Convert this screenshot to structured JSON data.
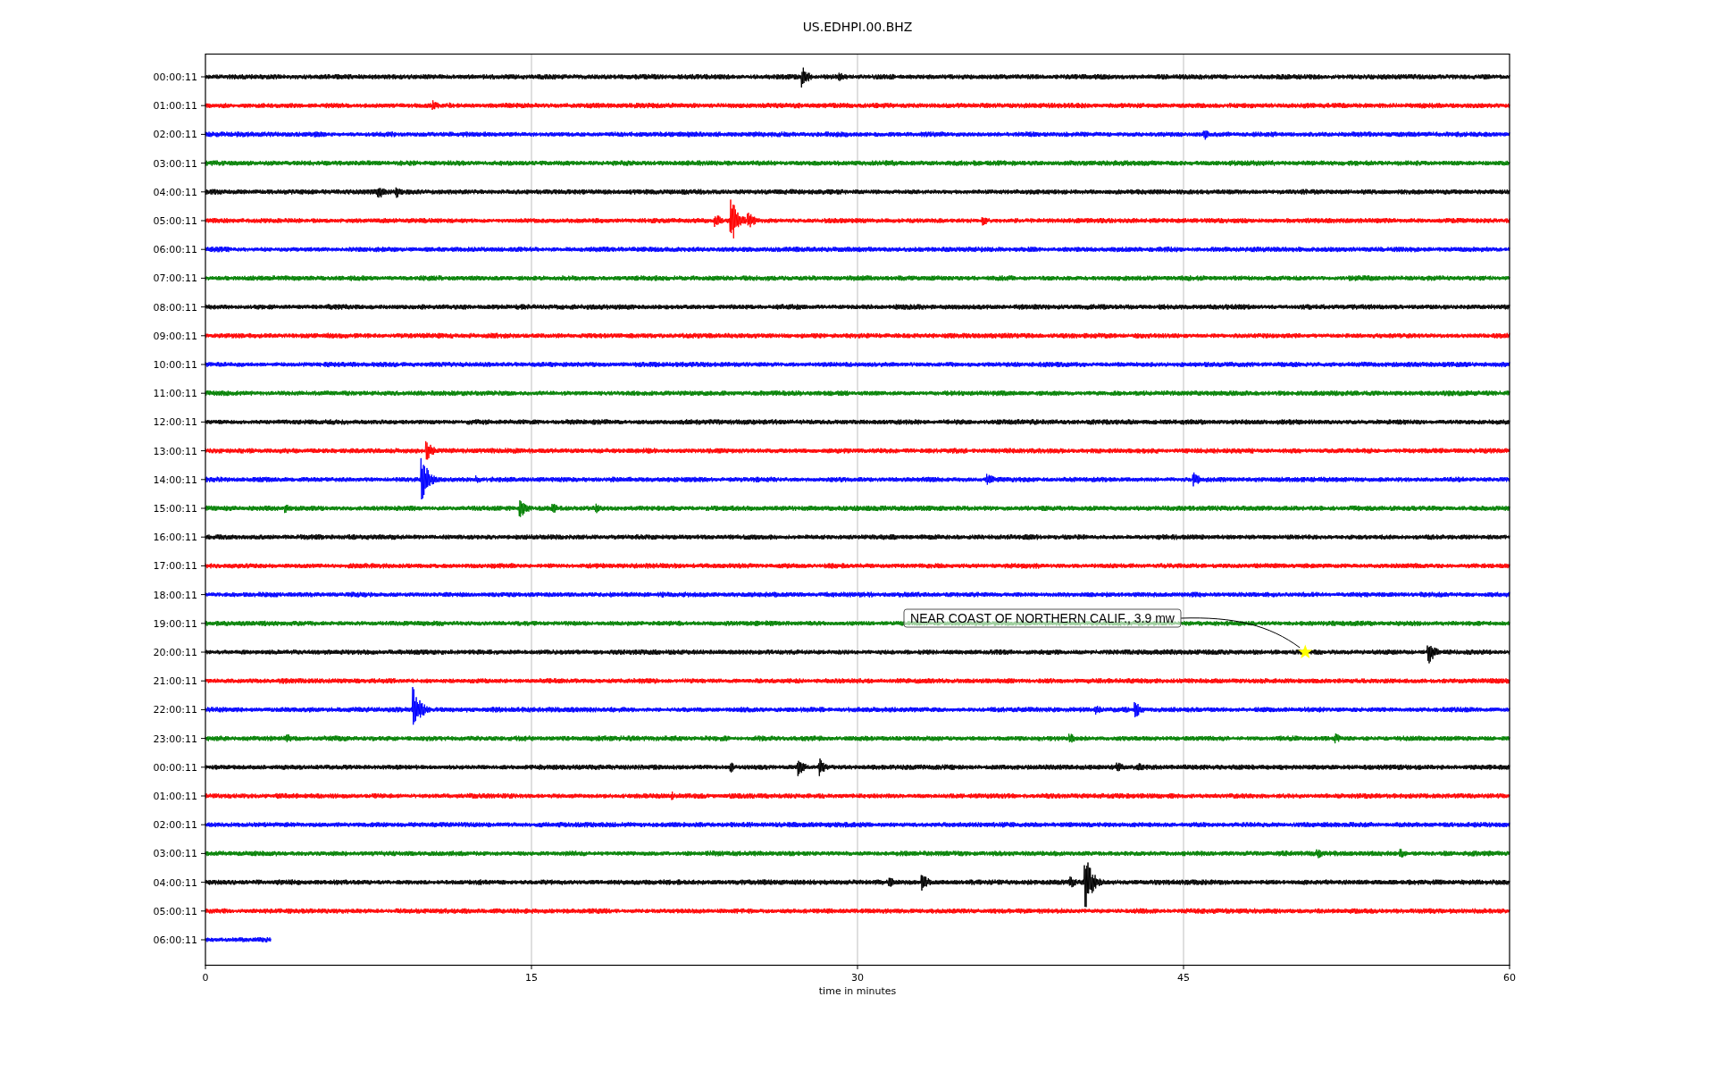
{
  "title": "US.EDHPI.00.BHZ",
  "plot": {
    "xlabel": "time in minutes",
    "xticks": [
      "0",
      "15",
      "30",
      "45",
      "60"
    ],
    "rows": [
      {
        "label": "00:00:11",
        "color": "#000000",
        "level": 1
      },
      {
        "label": "01:00:11",
        "color": "#ff0000",
        "level": 1
      },
      {
        "label": "02:00:11",
        "color": "#0000ff",
        "level": 1
      },
      {
        "label": "03:00:11",
        "color": "#008000",
        "level": 1
      },
      {
        "label": "04:00:11",
        "color": "#000000",
        "level": 1
      },
      {
        "label": "05:00:11",
        "color": "#ff0000",
        "level": 1
      },
      {
        "label": "06:00:11",
        "color": "#0000ff",
        "level": 1
      },
      {
        "label": "07:00:11",
        "color": "#008000",
        "level": 1
      },
      {
        "label": "08:00:11",
        "color": "#000000",
        "level": 1
      },
      {
        "label": "09:00:11",
        "color": "#ff0000",
        "level": 1
      },
      {
        "label": "10:00:11",
        "color": "#0000ff",
        "level": 1
      },
      {
        "label": "11:00:11",
        "color": "#008000",
        "level": 1
      },
      {
        "label": "12:00:11",
        "color": "#000000",
        "level": 1
      },
      {
        "label": "13:00:11",
        "color": "#ff0000",
        "level": 1
      },
      {
        "label": "14:00:11",
        "color": "#0000ff",
        "level": 1
      },
      {
        "label": "15:00:11",
        "color": "#008000",
        "level": 1
      },
      {
        "label": "16:00:11",
        "color": "#000000",
        "level": 1
      },
      {
        "label": "17:00:11",
        "color": "#ff0000",
        "level": 1
      },
      {
        "label": "18:00:11",
        "color": "#0000ff",
        "level": 1
      },
      {
        "label": "19:00:11",
        "color": "#008000",
        "level": 1
      },
      {
        "label": "20:00:11",
        "color": "#000000",
        "level": 1
      },
      {
        "label": "21:00:11",
        "color": "#ff0000",
        "level": 1
      },
      {
        "label": "22:00:11",
        "color": "#0000ff",
        "level": 1
      },
      {
        "label": "23:00:11",
        "color": "#008000",
        "level": 1
      },
      {
        "label": "00:00:11",
        "color": "#000000",
        "level": 1
      },
      {
        "label": "01:00:11",
        "color": "#ff0000",
        "level": 1
      },
      {
        "label": "02:00:11",
        "color": "#0000ff",
        "level": 1
      },
      {
        "label": "03:00:11",
        "color": "#008000",
        "level": 1
      },
      {
        "label": "04:00:11",
        "color": "#000000",
        "level": 1
      },
      {
        "label": "05:00:11",
        "color": "#ff0000",
        "level": 1
      },
      {
        "label": "06:00:11",
        "color": "#0000ff",
        "level": 0.05
      }
    ],
    "annotation": {
      "text": "NEAR COAST OF NORTHERN CALIF., 3.9 mw"
    }
  }
}
